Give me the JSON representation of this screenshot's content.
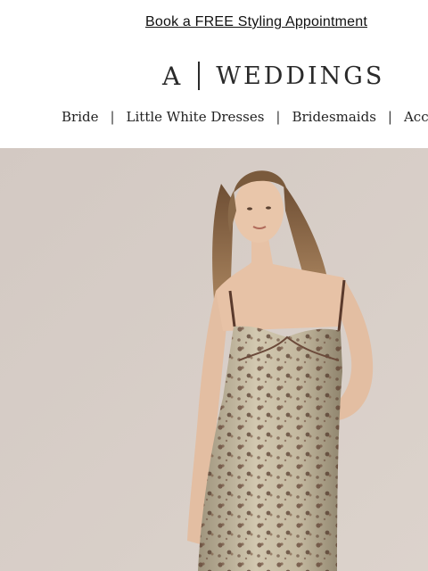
{
  "promo": {
    "link_text": "Book a FREE Styling Appointment"
  },
  "logo": {
    "mark": "A",
    "word": "WEDDINGS"
  },
  "nav": {
    "items": [
      {
        "label": "Bride"
      },
      {
        "label": "Little White Dresses"
      },
      {
        "label": "Bridesmaids"
      },
      {
        "label": "Acces"
      }
    ],
    "separator": "|"
  },
  "hero": {
    "description": "Model in floral metallic slip dress",
    "colors": {
      "background": "#d8cfc8",
      "dress": "#b9ad94",
      "floral": "#6b4a3a",
      "hair": "#8a6a4a",
      "skin": "#e7c2a6"
    }
  }
}
